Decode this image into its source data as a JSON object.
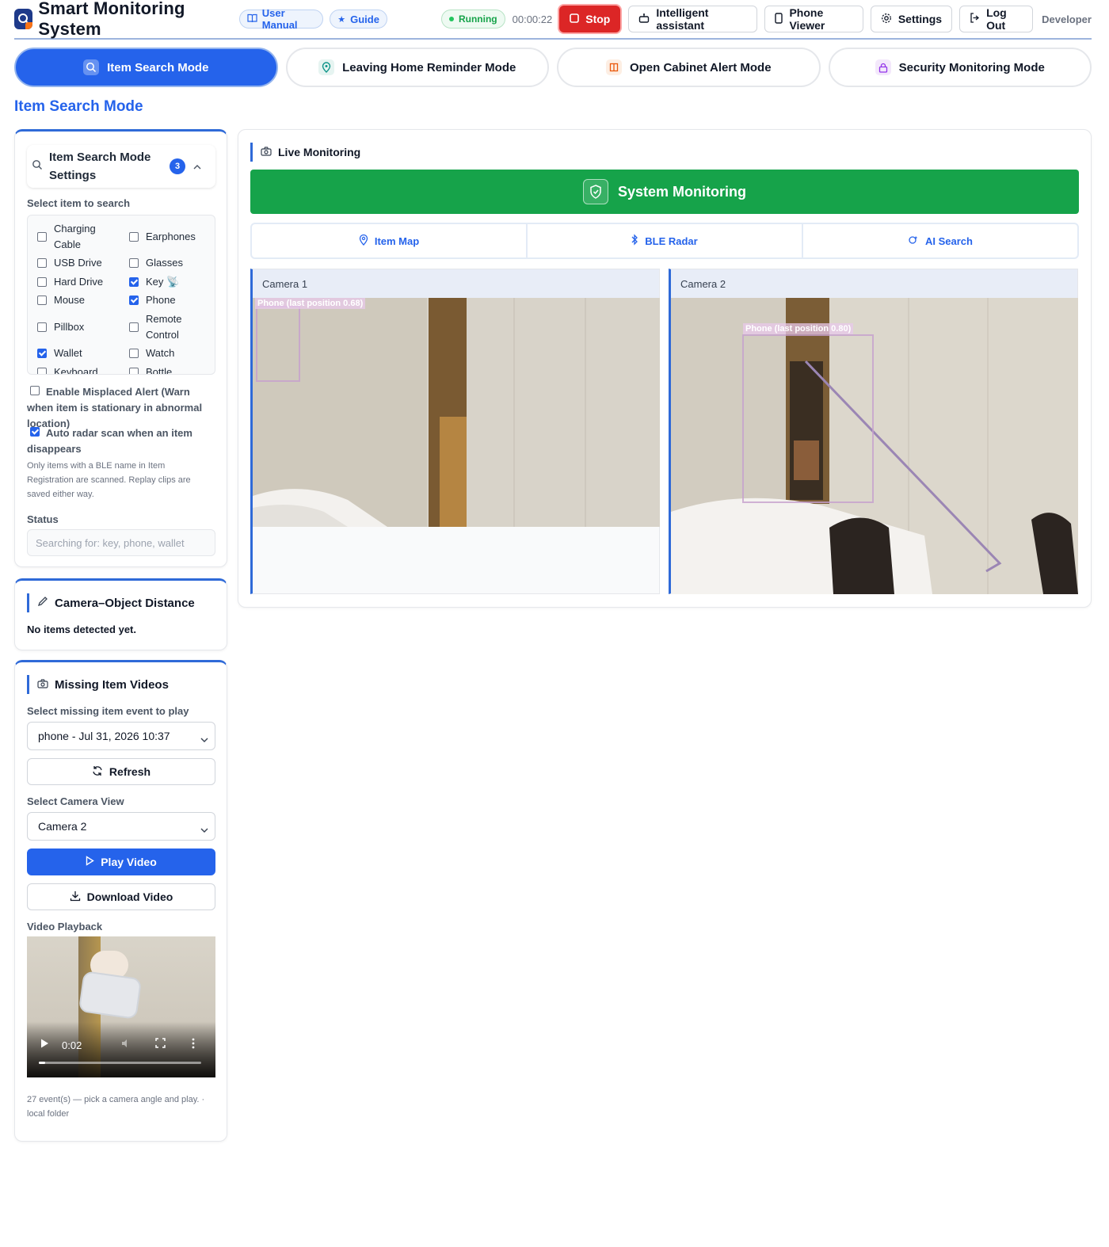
{
  "header": {
    "title": "Smart Monitoring System",
    "user_manual": "User Manual",
    "guide": "Guide",
    "status": "Running",
    "timer": "00:00:22",
    "stop": "Stop",
    "assistant": "Intelligent assistant",
    "phone_viewer": "Phone Viewer",
    "settings": "Settings",
    "logout": "Log Out",
    "role": "Developer"
  },
  "modes": [
    {
      "label": "Item Search Mode",
      "icon": "search-icon",
      "active": true
    },
    {
      "label": "Leaving Home Reminder Mode",
      "icon": "location-pin-icon",
      "active": false
    },
    {
      "label": "Open Cabinet Alert Mode",
      "icon": "cabinet-icon",
      "active": false
    },
    {
      "label": "Security Monitoring Mode",
      "icon": "lock-icon",
      "active": false
    }
  ],
  "section_title": "Item Search Mode",
  "settings": {
    "title": "Item Search Mode Settings",
    "badge": "3",
    "select_label": "Select item to search",
    "items": [
      {
        "label": "Charging Cable",
        "checked": false
      },
      {
        "label": "Earphones",
        "checked": false
      },
      {
        "label": "USB Drive",
        "checked": false
      },
      {
        "label": "Glasses",
        "checked": false
      },
      {
        "label": "Hard Drive",
        "checked": false
      },
      {
        "label": "Key 📡",
        "checked": true
      },
      {
        "label": "Mouse",
        "checked": false
      },
      {
        "label": "Phone",
        "checked": true
      },
      {
        "label": "Pillbox",
        "checked": false
      },
      {
        "label": "Remote Control",
        "checked": false
      },
      {
        "label": "Wallet",
        "checked": true
      },
      {
        "label": "Watch",
        "checked": false
      },
      {
        "label": "Keyboard",
        "checked": false
      },
      {
        "label": "Bottle",
        "checked": false
      }
    ],
    "misplaced_alert": {
      "label": "Enable Misplaced Alert (Warn when item is stationary in abnormal location)",
      "checked": false
    },
    "auto_radar": {
      "label": "Auto radar scan when an item disappears",
      "checked": true
    },
    "note": "Only items with a BLE name in Item Registration are scanned. Replay clips are saved either way.",
    "status_label": "Status",
    "status_value": "Searching for: key, phone, wallet"
  },
  "distance": {
    "title": "Camera–Object Distance",
    "empty": "No items detected yet."
  },
  "videos": {
    "title": "Missing Item Videos",
    "event_label": "Select missing item event to play",
    "event_value": "phone - Jul 31, 2026 10:37",
    "refresh": "Refresh",
    "camera_label": "Select Camera View",
    "camera_value": "Camera 2",
    "play": "Play Video",
    "download": "Download Video",
    "playback_label": "Video Playback",
    "playback_time": "0:02",
    "playback_progress": 0.04,
    "footer": "27 event(s) — pick a camera angle and play. · local folder"
  },
  "live": {
    "title": "Live Monitoring",
    "banner": "System Monitoring",
    "tabs": [
      "Item Map",
      "BLE Radar",
      "AI Search"
    ],
    "cameras": [
      {
        "name": "Camera 1",
        "detection": "Phone (last position 0.68)"
      },
      {
        "name": "Camera 2",
        "detection": "Phone (last position 0.80)"
      }
    ]
  },
  "colors": {
    "accent": "#2563eb",
    "success": "#16a34a",
    "danger": "#dc2626"
  }
}
